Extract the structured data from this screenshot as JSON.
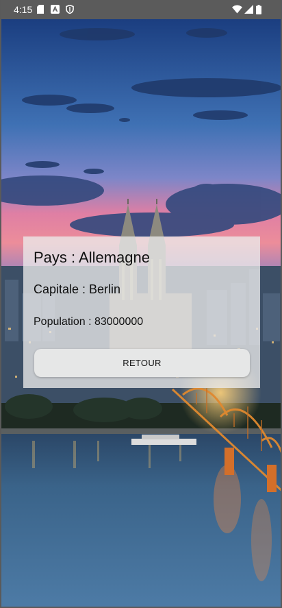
{
  "status_bar": {
    "time": "4:15",
    "left_icons": [
      "sd-card-icon",
      "a-notification-icon",
      "shield-icon"
    ],
    "right_icons": [
      "wifi-icon",
      "signal-icon",
      "battery-icon"
    ]
  },
  "background": {
    "image": "cologne-cathedral-night-skyline"
  },
  "card": {
    "country": "Pays : Allemagne",
    "capital": "Capitale : Berlin",
    "population": "Population : 83000000",
    "back_button": "RETOUR"
  }
}
